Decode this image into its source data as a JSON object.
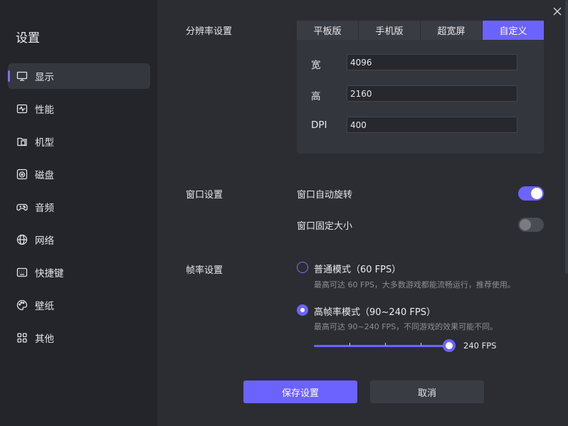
{
  "colors": {
    "accent": "#6c63ff",
    "sidebar_bg": "#23252b",
    "content_bg": "#2b2d33"
  },
  "sidebar": {
    "title": "设置",
    "items": [
      {
        "label": "显示",
        "icon": "monitor-icon",
        "active": true
      },
      {
        "label": "性能",
        "icon": "performance-icon"
      },
      {
        "label": "机型",
        "icon": "device-icon"
      },
      {
        "label": "磁盘",
        "icon": "disk-icon"
      },
      {
        "label": "音频",
        "icon": "gamepad-icon"
      },
      {
        "label": "网络",
        "icon": "globe-icon"
      },
      {
        "label": "快捷键",
        "icon": "keyboard-icon"
      },
      {
        "label": "壁纸",
        "icon": "palette-icon"
      },
      {
        "label": "其他",
        "icon": "grid-icon"
      }
    ]
  },
  "resolution": {
    "label": "分辨率设置",
    "tabs": [
      {
        "label": "平板版"
      },
      {
        "label": "手机版"
      },
      {
        "label": "超宽屏"
      },
      {
        "label": "自定义",
        "active": true
      }
    ],
    "width_label": "宽",
    "width_value": "4096",
    "height_label": "高",
    "height_value": "2160",
    "dpi_label": "DPI",
    "dpi_value": "400"
  },
  "window": {
    "label": "窗口设置",
    "auto_rotate_label": "窗口自动旋转",
    "auto_rotate_on": true,
    "fixed_size_label": "窗口固定大小",
    "fixed_size_on": false
  },
  "framerate": {
    "label": "帧率设置",
    "normal": {
      "title": "普通模式（60 FPS）",
      "desc": "最高可达 60 FPS，大多数游戏都能流畅运行，推荐使用。",
      "selected": false
    },
    "high": {
      "title": "高帧率模式（90~240 FPS）",
      "desc": "最高可达 90~240 FPS，不同游戏的效果可能不同。",
      "selected": true
    },
    "slider_value": "240 FPS",
    "slider_fraction": 1.0
  },
  "footer": {
    "save_label": "保存设置",
    "cancel_label": "取消"
  }
}
